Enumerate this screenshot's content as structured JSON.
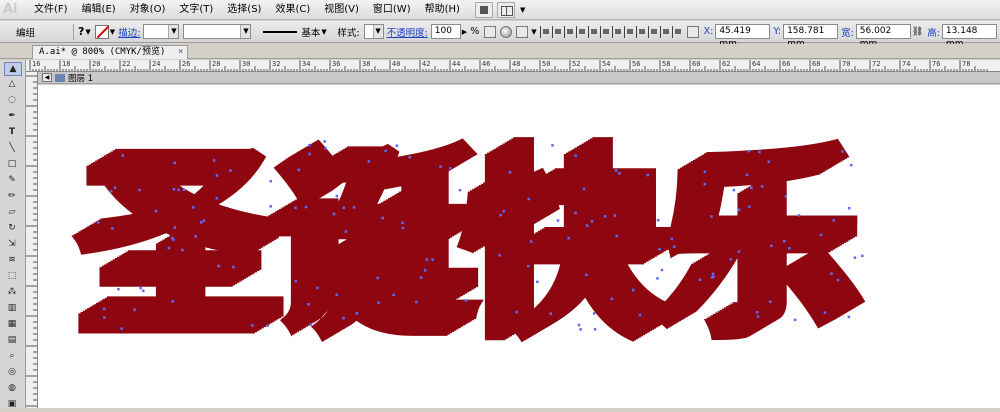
{
  "app": {
    "logo": "Ai"
  },
  "menu": [
    {
      "label": "文件(F)"
    },
    {
      "label": "编辑(E)"
    },
    {
      "label": "对象(O)"
    },
    {
      "label": "文字(T)"
    },
    {
      "label": "选择(S)"
    },
    {
      "label": "效果(C)"
    },
    {
      "label": "视图(V)"
    },
    {
      "label": "窗口(W)"
    },
    {
      "label": "帮助(H)"
    }
  ],
  "control": {
    "mode": "编组",
    "stroke_label": "描边:",
    "stroke_style": "基本",
    "style_label": "样式:",
    "opacity_label": "不透明度:",
    "opacity_value": "100",
    "opacity_unit": "%",
    "x_label": "X:",
    "x_value": "45.419 mm",
    "y_label": "Y:",
    "y_value": "158.781 mm",
    "w_label": "宽:",
    "w_value": "56.002 mm",
    "h_label": "高:",
    "h_value": "13.148 mm"
  },
  "document": {
    "tab_title": "A.ai* @ 800% (CMYK/预览)",
    "close": "×",
    "layer_name": "图层 1"
  },
  "ruler": {
    "ticks": [
      "16",
      "18",
      "20",
      "22",
      "24",
      "26",
      "28",
      "30",
      "32",
      "34",
      "36",
      "38",
      "40",
      "42",
      "44",
      "46",
      "48",
      "50",
      "52",
      "54",
      "56",
      "58",
      "60",
      "62",
      "64",
      "66",
      "68",
      "70",
      "72",
      "74",
      "76",
      "78"
    ]
  },
  "artwork": {
    "text": "圣诞快乐",
    "face_color": "#d9081b",
    "extrude_color": "#8e0710",
    "anchor_color": "#5a6cff"
  }
}
